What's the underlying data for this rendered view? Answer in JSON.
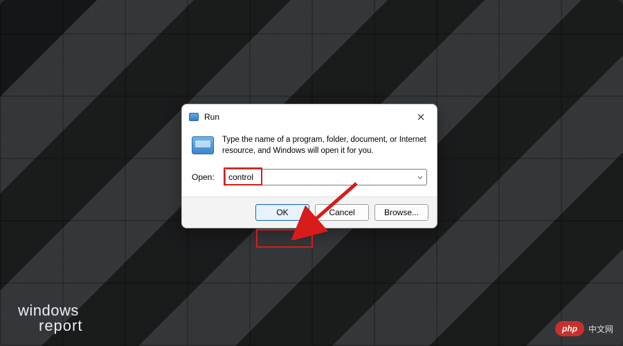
{
  "dialog": {
    "title": "Run",
    "description": "Type the name of a program, folder, document, or Internet resource, and Windows will open it for you.",
    "open_label": "Open:",
    "input_value": "control",
    "buttons": {
      "ok": "OK",
      "cancel": "Cancel",
      "browse": "Browse..."
    }
  },
  "watermark": {
    "left_line1": "windows",
    "left_line2": "report",
    "right_badge": "php",
    "right_text": "中文网"
  }
}
